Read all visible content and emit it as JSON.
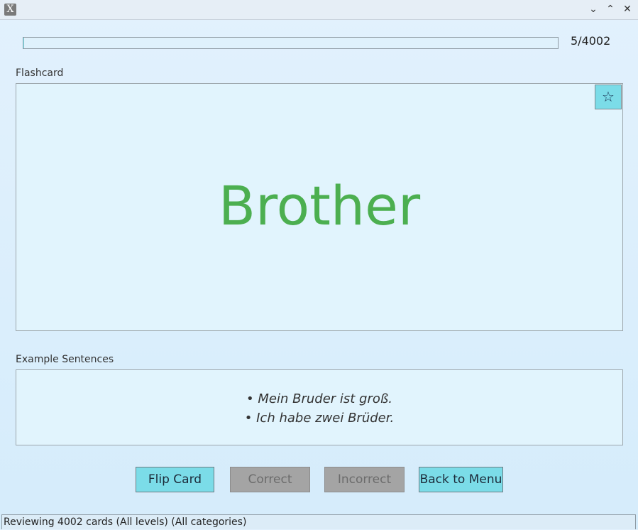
{
  "window": {
    "app_icon": "x-window-icon",
    "controls": [
      "minimize-icon",
      "maximize-icon",
      "close-icon"
    ]
  },
  "progress": {
    "current": 5,
    "total": 4002,
    "text": "5/4002"
  },
  "flashcard": {
    "section_label": "Flashcard",
    "word": "Brother",
    "star_icon": "☆",
    "word_color": "#4caf50"
  },
  "examples": {
    "section_label": "Example Sentences",
    "sentences": [
      "• Mein Bruder ist groß.",
      "• Ich habe zwei Brüder."
    ]
  },
  "buttons": {
    "flip": "Flip Card",
    "correct": "Correct",
    "incorrect": "Incorrect",
    "back": "Back to Menu"
  },
  "status": {
    "text": "Reviewing 4002 cards (All levels) (All categories)"
  },
  "colors": {
    "accent": "#7bdce8",
    "disabled": "#a4a4a4"
  }
}
